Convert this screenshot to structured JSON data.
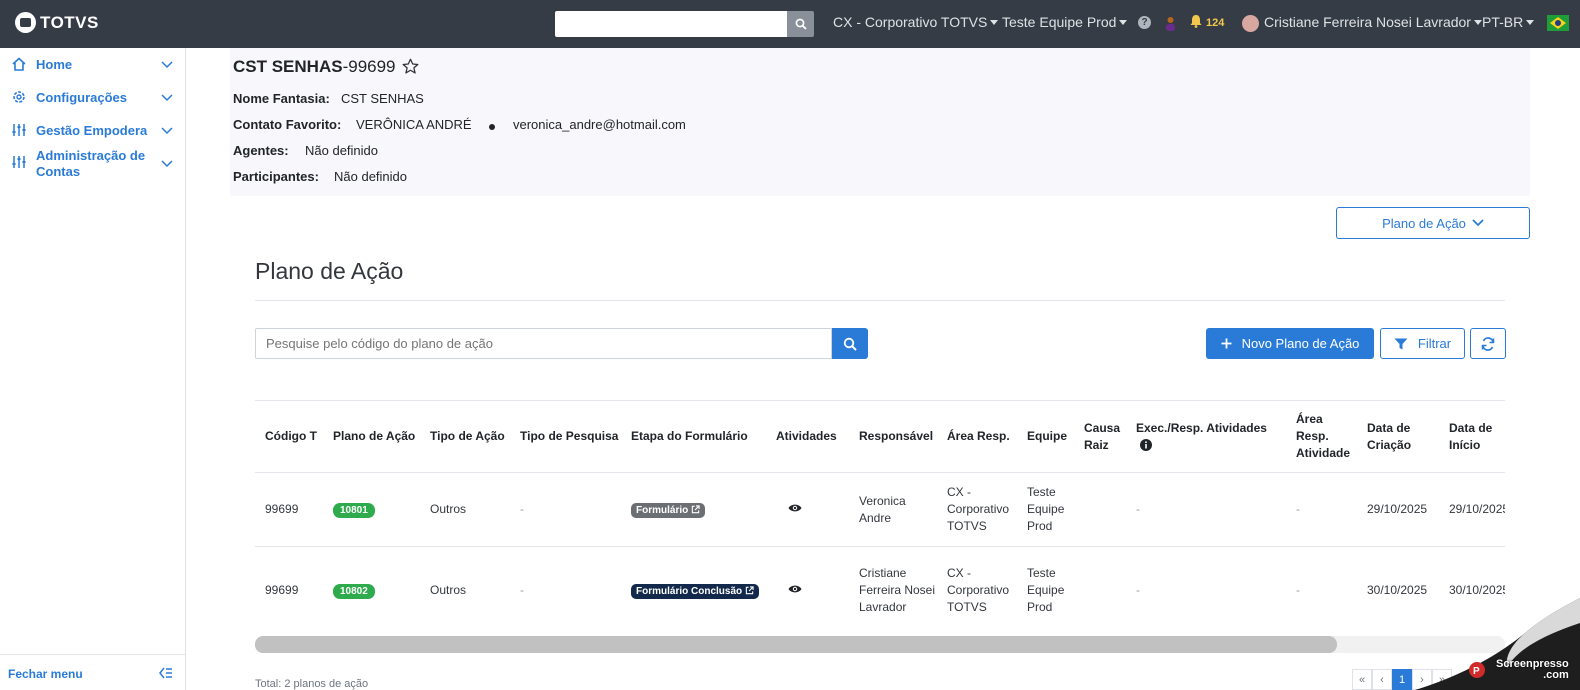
{
  "topbar": {
    "brand": "TOTVS",
    "search_value": "",
    "company": "CX - Corporativo TOTVS",
    "team": "Teste Equipe Prod",
    "notifications": "124",
    "user": "Cristiane Ferreira Nosei Lavrador",
    "language": "PT-BR"
  },
  "sidebar": {
    "items": [
      {
        "label": "Home",
        "icon": "home-icon"
      },
      {
        "label": "Configurações",
        "icon": "gear-icon"
      },
      {
        "label": "Gestão Empodera",
        "icon": "sliders-icon"
      },
      {
        "label": "Administração de Contas",
        "icon": "sliders-icon"
      }
    ],
    "footer": "Fechar menu"
  },
  "header": {
    "title_bold": "CST SENHAS",
    "title_code": "-99699",
    "nome_fantasia_label": "Nome Fantasia:",
    "nome_fantasia": "CST SENHAS",
    "contato_label": "Contato Favorito:",
    "contato_nome": "VERÔNICA ANDRÉ",
    "contato_email": "veronica_andre@hotmail.com",
    "agentes_label": "Agentes:",
    "agentes": "Não definido",
    "participantes_label": "Participantes:",
    "participantes": "Não definido"
  },
  "plano_dropdown": "Plano de Ação",
  "section_title": "Plano de Ação",
  "search": {
    "placeholder": "Pesquise pelo código do plano de ação"
  },
  "buttons": {
    "novo": "Novo Plano de Ação",
    "filtrar": "Filtrar"
  },
  "table": {
    "columns": [
      "Código T",
      "Plano de Ação",
      "Tipo de Ação",
      "Tipo de Pesquisa",
      "Etapa do Formulário",
      "Atividades",
      "Responsável",
      "Área Resp.",
      "Equipe",
      "Causa Raiz",
      "Exec./Resp. Atividades",
      "Área Resp. Atividade",
      "Data de Criação",
      "Data de Início"
    ],
    "rows": [
      {
        "codigo": "99699",
        "plano": "10801",
        "tipo_acao": "Outros",
        "tipo_pesquisa": "-",
        "etapa": "Formulário",
        "responsavel": "Veronica Andre",
        "area": "CX - Corporativo TOTVS",
        "equipe": "Teste Equipe Prod",
        "causa": "",
        "exec": "-",
        "area_ativ": "-",
        "criacao": "29/10/2025",
        "inicio": "29/10/2025"
      },
      {
        "codigo": "99699",
        "plano": "10802",
        "tipo_acao": "Outros",
        "tipo_pesquisa": "-",
        "etapa": "Formulário Conclusão",
        "responsavel": "Cristiane Ferreira Nosei Lavrador",
        "area": "CX - Corporativo TOTVS",
        "equipe": "Teste Equipe Prod",
        "causa": "",
        "exec": "-",
        "area_ativ": "-",
        "criacao": "30/10/2025",
        "inicio": "30/10/2025"
      }
    ]
  },
  "footer": {
    "total": "Total: 2 planos de ação",
    "page": "1",
    "first": "«",
    "prev": "‹",
    "next": "›",
    "last": "»"
  },
  "watermark": {
    "line1": "Screenpresso",
    "line2": ".com"
  },
  "colors": {
    "accent": "#2a7bd8",
    "topbar": "#363c45",
    "pill_green": "#2eab4c",
    "tag_navy": "#13294b"
  }
}
